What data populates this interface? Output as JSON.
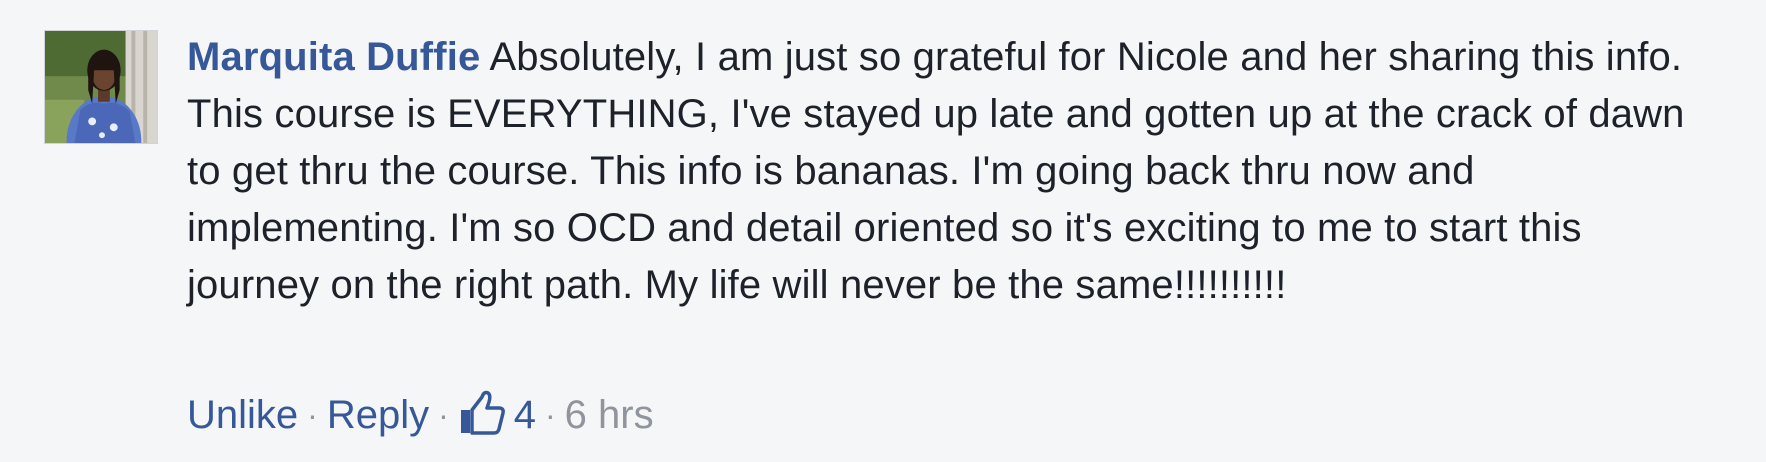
{
  "comment": {
    "author": "Marquita Duffie",
    "text": "Absolutely, I am just so grateful for Nicole and her sharing this info. This course is EVERYTHING, I've stayed up late and gotten up at the crack of dawn to get thru the course. This info is bananas. I'm going back thru now and implementing. I'm so OCD and detail oriented so it's exciting to me to start this journey on the right path. My life will never be the same!!!!!!!!!!"
  },
  "actions": {
    "unlike_label": "Unlike",
    "reply_label": "Reply",
    "separator": "·",
    "like_count": "4",
    "timestamp": "6 hrs"
  },
  "colors": {
    "background": "#f5f6f8",
    "link": "#365899",
    "text": "#1d2129",
    "muted": "#90949c"
  },
  "icons": {
    "like": "thumbs-up-icon",
    "avatar": "profile-photo"
  }
}
